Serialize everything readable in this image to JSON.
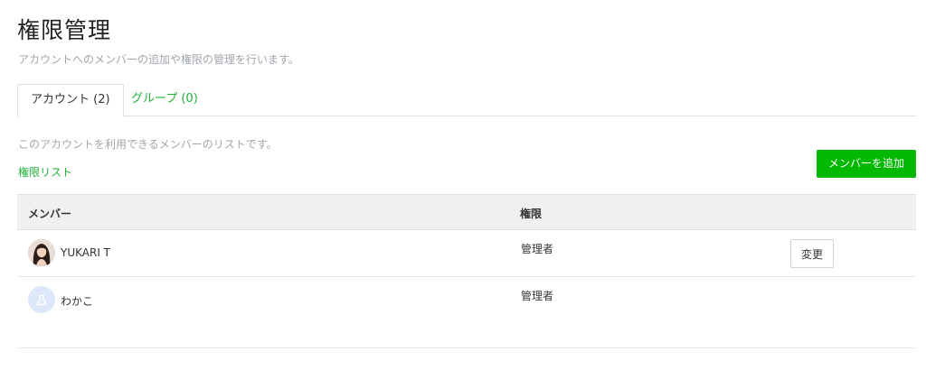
{
  "header": {
    "title": "権限管理",
    "subtitle": "アカウントへのメンバーの追加や権限の管理を行います。"
  },
  "tabs": [
    {
      "label": "アカウント (2)",
      "active": true
    },
    {
      "label": "グループ (0)",
      "active": false
    }
  ],
  "section": {
    "description": "このアカウントを利用できるメンバーのリストです。",
    "permission_list_link": "権限リスト",
    "add_member_button": "メンバーを追加"
  },
  "table": {
    "columns": {
      "member": "メンバー",
      "permission": "権限"
    },
    "rows": [
      {
        "name": "YUKARI T",
        "permission": "管理者",
        "action": "変更",
        "avatar": "user-photo"
      },
      {
        "name": "わかこ",
        "permission": "管理者",
        "avatar": "default-user-icon"
      }
    ]
  },
  "colors": {
    "accent_green": "#00b900",
    "link_green": "#1fb139",
    "header_bg": "#eef0f2",
    "muted_text": "#a0a6ad"
  }
}
